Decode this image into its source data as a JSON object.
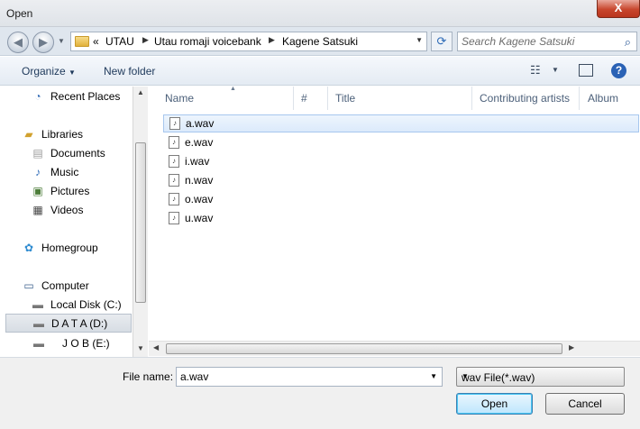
{
  "window": {
    "title": "Open",
    "close_glyph": "X"
  },
  "address": {
    "overflow": "«",
    "crumbs": [
      "UTAU",
      "Utau romaji voicebank",
      "Kagene Satsuki"
    ],
    "search_placeholder": "Search Kagene Satsuki"
  },
  "toolbar": {
    "organize": "Organize",
    "new_folder": "New folder"
  },
  "nav": {
    "items": [
      {
        "label": "Recent Places",
        "icon": "recent-places-icon"
      },
      {
        "label": "Libraries",
        "icon": "libraries-icon"
      },
      {
        "label": "Documents",
        "icon": "documents-icon"
      },
      {
        "label": "Music",
        "icon": "music-icon"
      },
      {
        "label": "Pictures",
        "icon": "pictures-icon"
      },
      {
        "label": "Videos",
        "icon": "videos-icon"
      },
      {
        "label": "Homegroup",
        "icon": "homegroup-icon"
      },
      {
        "label": "Computer",
        "icon": "computer-icon"
      },
      {
        "label": "Local Disk (C:)",
        "icon": "local-disk-icon"
      },
      {
        "label": "D A T A (D:)",
        "icon": "drive-icon",
        "selected": true
      },
      {
        "label": "J O B (E:)",
        "icon": "drive-icon"
      }
    ]
  },
  "columns": [
    "Name",
    "#",
    "Title",
    "Contributing artists",
    "Album"
  ],
  "files": [
    {
      "name": "a.wav",
      "selected": true
    },
    {
      "name": "e.wav"
    },
    {
      "name": "i.wav"
    },
    {
      "name": "n.wav"
    },
    {
      "name": "o.wav"
    },
    {
      "name": "u.wav"
    }
  ],
  "bottom": {
    "file_name_label": "File name:",
    "file_name_value": "a.wav",
    "file_type": "wav File(*.wav)",
    "open_label": "Open",
    "cancel_label": "Cancel"
  }
}
